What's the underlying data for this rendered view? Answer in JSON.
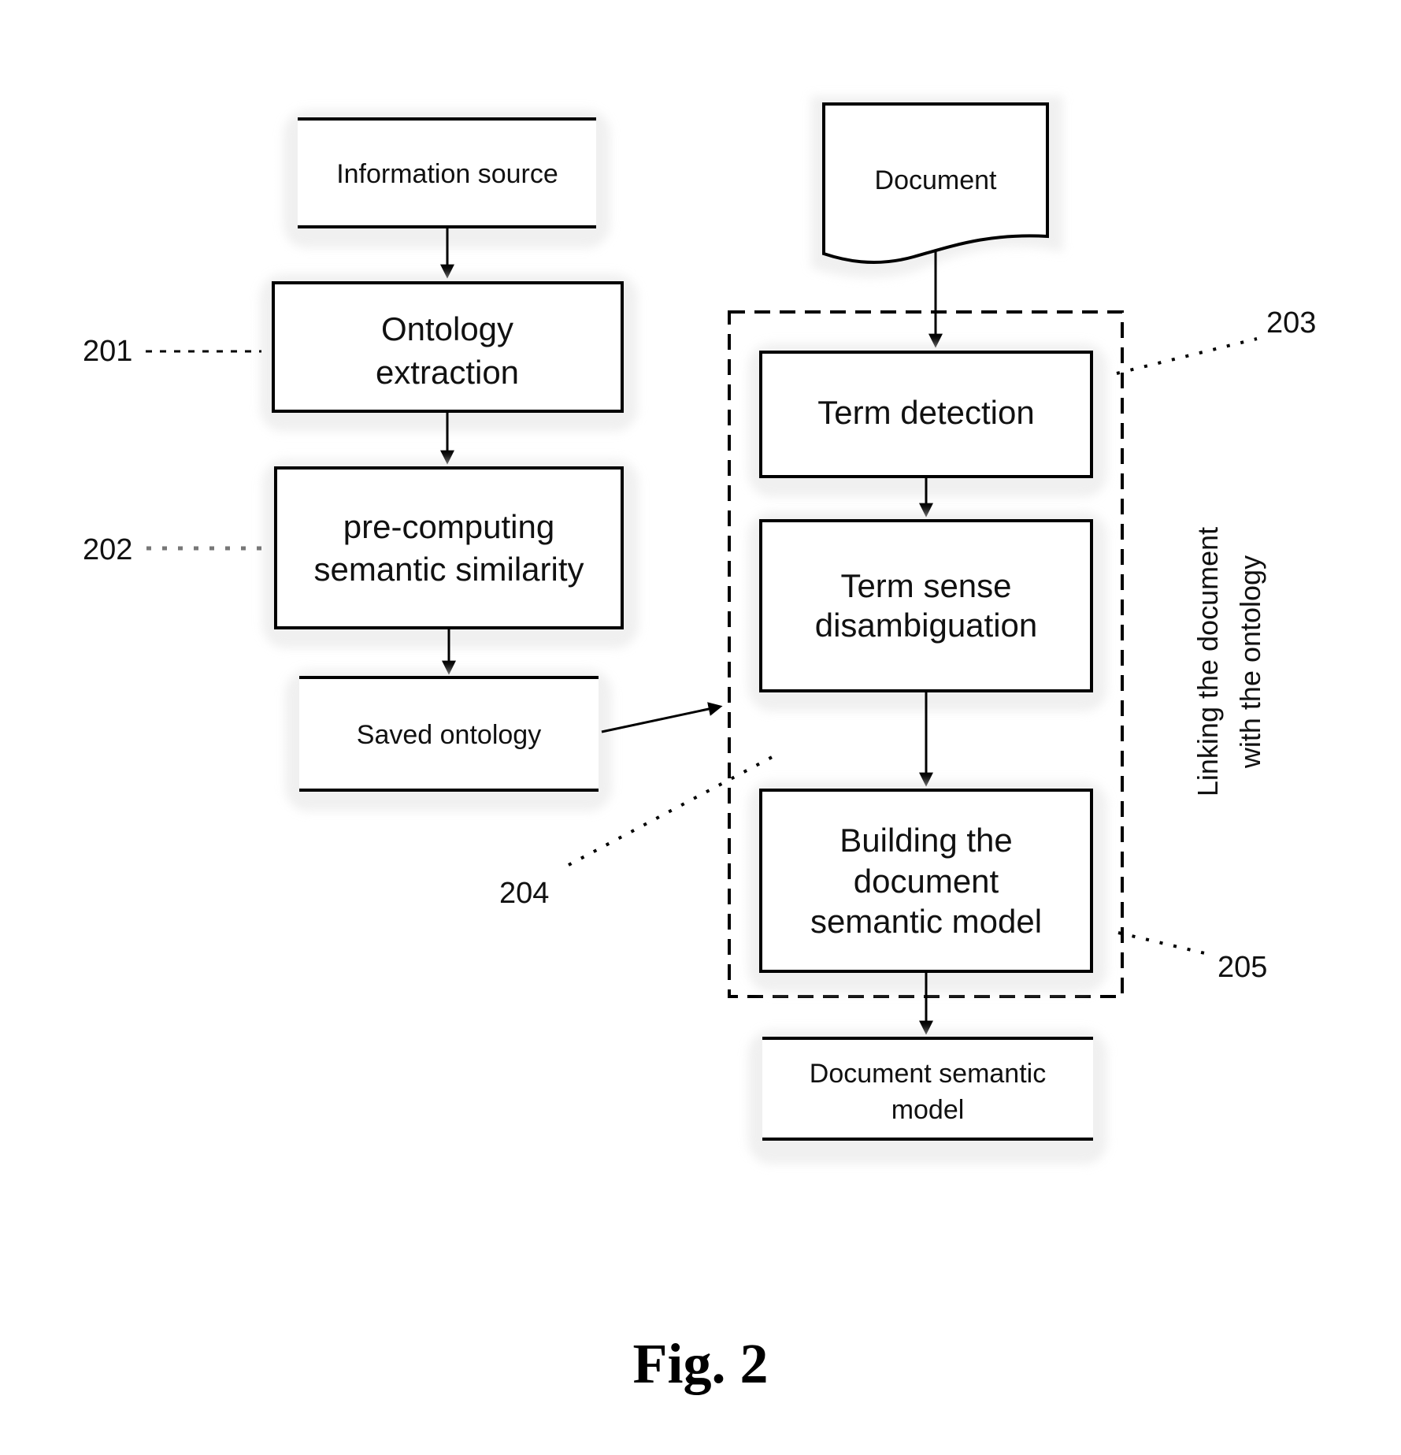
{
  "figure": {
    "caption": "Fig. 2"
  },
  "left_column": {
    "information_source": {
      "lines": [
        "Information source"
      ]
    },
    "ontology_extraction": {
      "ref": "201",
      "lines": [
        "Ontology",
        "extraction"
      ]
    },
    "precomputing": {
      "ref": "202",
      "lines": [
        "pre-computing",
        "semantic similarity"
      ]
    },
    "saved_ontology": {
      "lines": [
        "Saved ontology"
      ]
    }
  },
  "right_column": {
    "document": {
      "lines": [
        "Document"
      ]
    },
    "linking_group": {
      "ref": "203",
      "side_label_lines": [
        "Linking the document",
        "with the ontology"
      ]
    },
    "term_detection": {
      "lines": [
        "Term detection"
      ]
    },
    "term_sense": {
      "ref": "204",
      "lines": [
        "Term sense",
        "disambiguation"
      ]
    },
    "building_model": {
      "ref": "205",
      "lines": [
        "Building the",
        "document",
        "semantic model"
      ]
    },
    "document_semantic_model": {
      "lines": [
        "Document semantic",
        "model"
      ]
    }
  }
}
